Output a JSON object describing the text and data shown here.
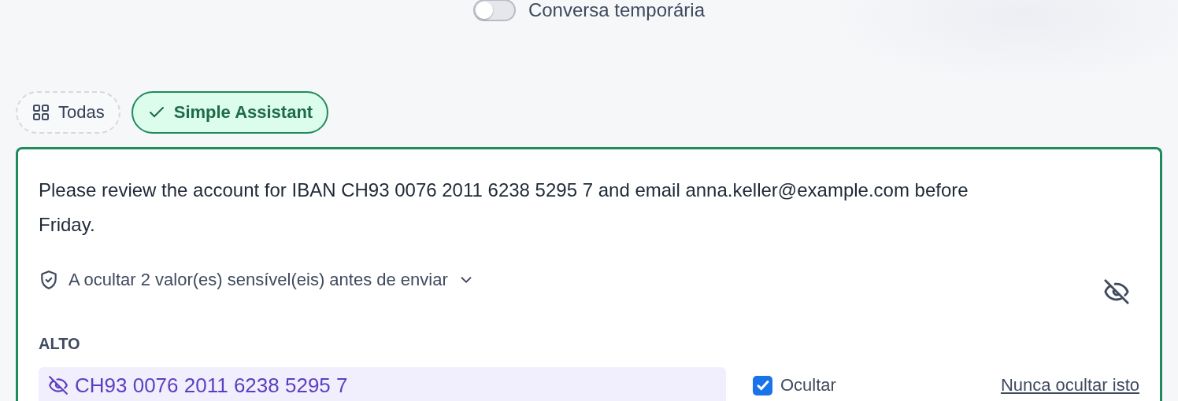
{
  "temporary_chat": {
    "label": "Conversa temporária",
    "on": false
  },
  "filters": [
    {
      "kind": "all",
      "label": "Todas",
      "selected": false
    },
    {
      "kind": "assistant",
      "label": "Simple Assistant",
      "selected": true
    }
  ],
  "composer": {
    "message": "Please review the account for IBAN CH93 0076 2011 6238 5295 7 and email anna.keller@example.com before Friday.",
    "notice": {
      "text": "A ocultar 2 valor(es) sensível(eis) antes de enviar",
      "expanded": false
    },
    "groups": [
      {
        "level": "ALTO",
        "items": [
          {
            "value": "CH93 0076 2011 6238 5295 7",
            "checked": true,
            "hide_label": "Ocultar",
            "never_label": "Nunca ocultar isto"
          }
        ]
      }
    ]
  }
}
